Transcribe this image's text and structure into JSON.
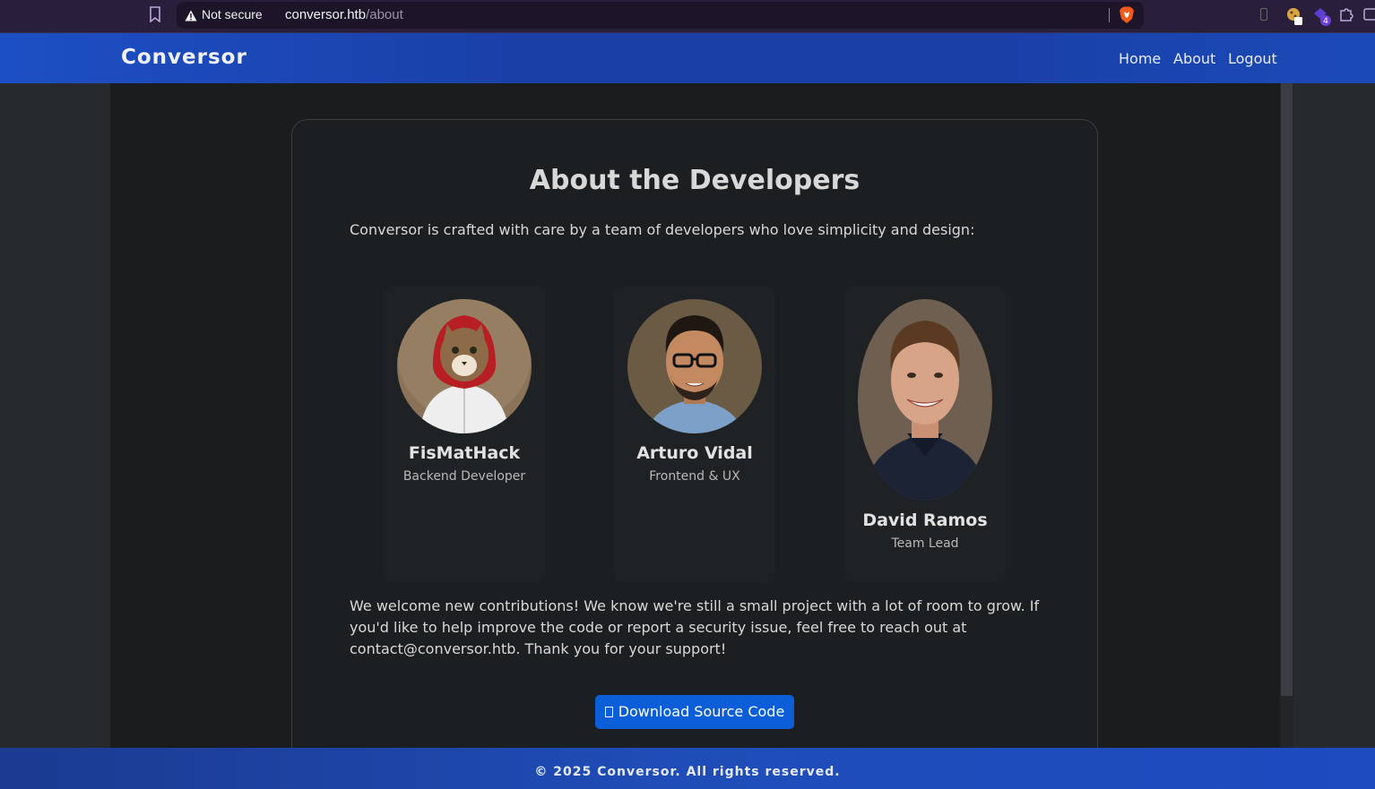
{
  "browser": {
    "security_label": "Not secure",
    "url_host": "conversor.htb",
    "url_path": "/about",
    "extension_badge": "4"
  },
  "navbar": {
    "brand": "Conversor",
    "links": [
      "Home",
      "About",
      "Logout"
    ]
  },
  "about": {
    "title": "About the Developers",
    "intro": "Conversor is crafted with care by a team of developers who love simplicity and design:",
    "developers": [
      {
        "name": "FisMatHack",
        "role": "Backend Developer",
        "avatar": "hooded-cat-avatar"
      },
      {
        "name": "Arturo Vidal",
        "role": "Frontend & UX",
        "avatar": "man-glasses-avatar"
      },
      {
        "name": "David Ramos",
        "role": "Team Lead",
        "avatar": "smiling-man-avatar"
      }
    ],
    "outro": "We welcome new contributions! We know we're still a small project with a lot of room to grow. If you'd like to help improve the code or report a security issue, feel free to reach out at contact@conversor.htb. Thank you for your support!",
    "download_label": "Download Source Code"
  },
  "footer": {
    "text": "© 2025 Conversor. All rights reserved."
  },
  "colors": {
    "nav_blue": "#1a3fa6",
    "button_blue": "#0b5ed7",
    "page_bg": "#1a1c1e"
  }
}
